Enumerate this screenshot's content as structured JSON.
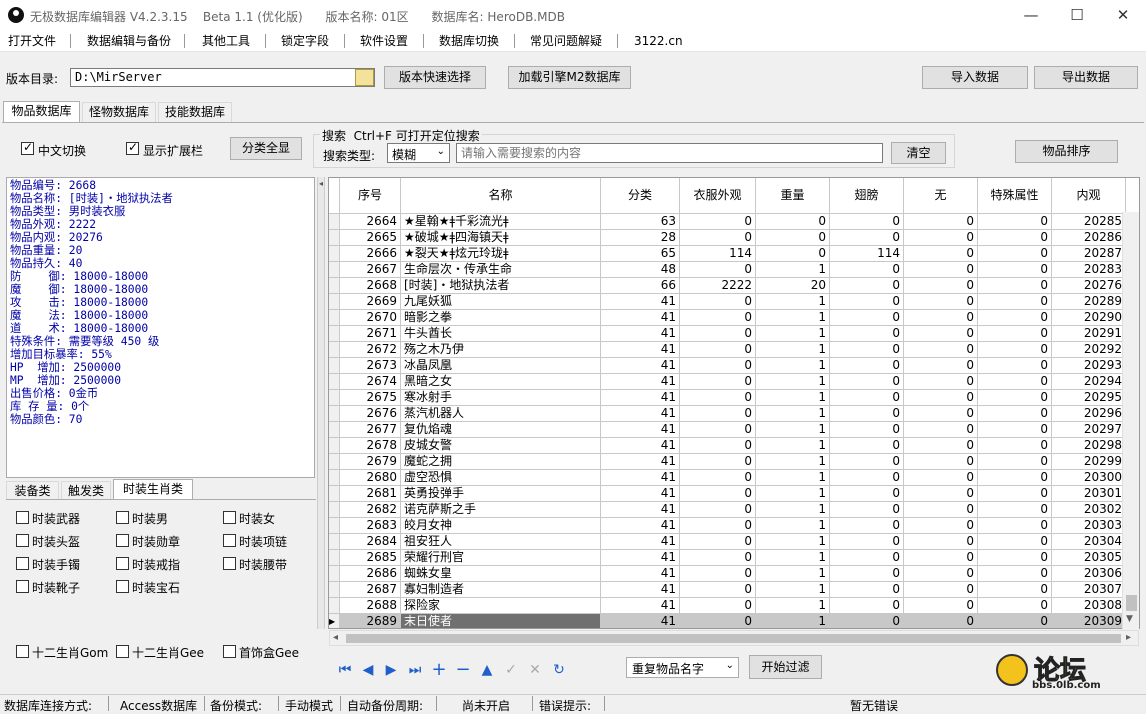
{
  "window": {
    "title": "无极数据库编辑器 V4.2.3.15    Beta 1.1 (优化版)      版本名称: 01区      数据库名: HeroDB.MDB",
    "minimize": "—",
    "maximize": "☐",
    "close": "✕"
  },
  "menu": [
    "打开文件",
    "数据编辑与备份",
    "其他工具",
    "锁定字段",
    "软件设置",
    "数据库切换",
    "常见问题解疑",
    "3122.cn"
  ],
  "toolbar": {
    "dir_label": "版本目录:",
    "dir_value": "D:\\MirServer",
    "quick_select": "版本快速选择",
    "load_m2": "加载引擎M2数据库",
    "import": "导入数据",
    "export": "导出数据"
  },
  "main_tabs": [
    "物品数据库",
    "怪物数据库",
    "技能数据库"
  ],
  "options": {
    "chinese_switch": "中文切换",
    "show_ext": "显示扩展栏",
    "show_all": "分类全显",
    "search_title": "搜索  Ctrl+F 可打开定位搜索",
    "search_type_label": "搜索类型:",
    "search_type_value": "模糊",
    "search_placeholder": "请输入需要搜索的内容",
    "clear": "清空",
    "sort": "物品排序"
  },
  "item_info": [
    "物品编号: 2668",
    "物品名称: [时装]・地狱执法者",
    "物品类型: 男时装衣服",
    "物品外观: 2222",
    "物品内观: 20276",
    "物品重量: 20",
    "物品持久: 40",
    "防    御: 18000-18000",
    "魔    御: 18000-18000",
    "攻    击: 18000-18000",
    "魔    法: 18000-18000",
    "道    术: 18000-18000",
    "特殊条件: 需要等级 450 级",
    "增加目标暴率: 55%",
    "HP  增加: 2500000",
    "MP  增加: 2500000",
    "出售价格: 0金币",
    "库 存 量: 0个",
    "物品颜色: 70"
  ],
  "category_tabs": [
    "装备类",
    "触发类",
    "时装生肖类"
  ],
  "category_checks": [
    "时装武器",
    "时装男",
    "时装女",
    "时装头盔",
    "时装勋章",
    "时装项链",
    "时装手镯",
    "时装戒指",
    "时装腰带",
    "时装靴子",
    "时装宝石"
  ],
  "zodiac_checks": [
    "十二生肖Gom",
    "十二生肖Gee",
    "首饰盒Gee"
  ],
  "grid": {
    "columns": [
      "序号",
      "名称",
      "分类",
      "衣服外观",
      "重量",
      "翅膀",
      "无",
      "特殊属性",
      "内观"
    ],
    "rows": [
      [
        "2664",
        "★星翰★ǂ千彩流光ǂ",
        "63",
        "0",
        "0",
        "0",
        "0",
        "0",
        "20285"
      ],
      [
        "2665",
        "★破城★ǂ四海镇天ǂ",
        "28",
        "0",
        "0",
        "0",
        "0",
        "0",
        "20286"
      ],
      [
        "2666",
        "★裂天★ǂ炫元玲珑ǂ",
        "65",
        "114",
        "0",
        "114",
        "0",
        "0",
        "20287"
      ],
      [
        "2667",
        "生命层次・传承生命",
        "48",
        "0",
        "1",
        "0",
        "0",
        "0",
        "20283"
      ],
      [
        "2668",
        "[时装]・地狱执法者",
        "66",
        "2222",
        "20",
        "0",
        "0",
        "0",
        "20276"
      ],
      [
        "2669",
        "九尾妖狐",
        "41",
        "0",
        "1",
        "0",
        "0",
        "0",
        "20289"
      ],
      [
        "2670",
        "暗影之拳",
        "41",
        "0",
        "1",
        "0",
        "0",
        "0",
        "20290"
      ],
      [
        "2671",
        "牛头酋长",
        "41",
        "0",
        "1",
        "0",
        "0",
        "0",
        "20291"
      ],
      [
        "2672",
        "殇之木乃伊",
        "41",
        "0",
        "1",
        "0",
        "0",
        "0",
        "20292"
      ],
      [
        "2673",
        "冰晶凤凰",
        "41",
        "0",
        "1",
        "0",
        "0",
        "0",
        "20293"
      ],
      [
        "2674",
        "黑暗之女",
        "41",
        "0",
        "1",
        "0",
        "0",
        "0",
        "20294"
      ],
      [
        "2675",
        "寒冰射手",
        "41",
        "0",
        "1",
        "0",
        "0",
        "0",
        "20295"
      ],
      [
        "2676",
        "蒸汽机器人",
        "41",
        "0",
        "1",
        "0",
        "0",
        "0",
        "20296"
      ],
      [
        "2677",
        "复仇焰魂",
        "41",
        "0",
        "1",
        "0",
        "0",
        "0",
        "20297"
      ],
      [
        "2678",
        "皮城女警",
        "41",
        "0",
        "1",
        "0",
        "0",
        "0",
        "20298"
      ],
      [
        "2679",
        "魔蛇之拥",
        "41",
        "0",
        "1",
        "0",
        "0",
        "0",
        "20299"
      ],
      [
        "2680",
        "虚空恐惧",
        "41",
        "0",
        "1",
        "0",
        "0",
        "0",
        "20300"
      ],
      [
        "2681",
        "英勇投弹手",
        "41",
        "0",
        "1",
        "0",
        "0",
        "0",
        "20301"
      ],
      [
        "2682",
        "诺克萨斯之手",
        "41",
        "0",
        "1",
        "0",
        "0",
        "0",
        "20302"
      ],
      [
        "2683",
        "皎月女神",
        "41",
        "0",
        "1",
        "0",
        "0",
        "0",
        "20303"
      ],
      [
        "2684",
        "祖安狂人",
        "41",
        "0",
        "1",
        "0",
        "0",
        "0",
        "20304"
      ],
      [
        "2685",
        "荣耀行刑官",
        "41",
        "0",
        "1",
        "0",
        "0",
        "0",
        "20305"
      ],
      [
        "2686",
        "蜘蛛女皇",
        "41",
        "0",
        "1",
        "0",
        "0",
        "0",
        "20306"
      ],
      [
        "2687",
        "寡妇制造者",
        "41",
        "0",
        "1",
        "0",
        "0",
        "0",
        "20307"
      ],
      [
        "2688",
        "探险家",
        "41",
        "0",
        "1",
        "0",
        "0",
        "0",
        "20308"
      ],
      [
        "2689",
        "末日使者",
        "41",
        "0",
        "1",
        "0",
        "0",
        "0",
        "20309"
      ]
    ],
    "selected_index": 25
  },
  "bottom": {
    "nav_icons": [
      "first-icon",
      "prior-icon",
      "next-icon",
      "last-icon",
      "insert-icon",
      "delete-icon",
      "edit-icon",
      "post-icon",
      "cancel-icon",
      "refresh-icon"
    ],
    "filter_value": "重复物品名字",
    "filter_button": "开始过滤"
  },
  "status": {
    "conn_label": "数据库连接方式:",
    "conn_value": "Access数据库",
    "backup_label": "备份模式:",
    "backup_value": "手动模式",
    "auto_label": "自动备份周期:",
    "auto_value": "尚未开启",
    "error_label": "错误提示:",
    "error_value": "暂无错误"
  },
  "watermark": {
    "main": "论坛",
    "url": "bbs.0lb.com"
  }
}
